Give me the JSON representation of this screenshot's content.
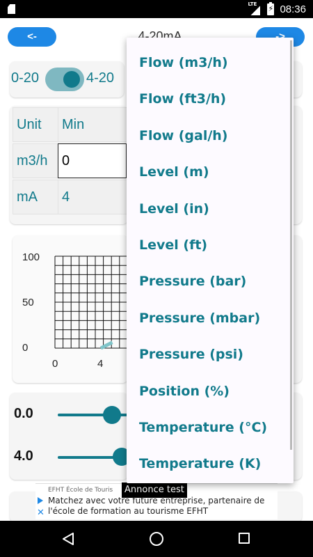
{
  "status_bar": {
    "time": "08:36",
    "network_label": "LTE",
    "battery_glyph": "⚡",
    "icons": [
      "sd-card-icon",
      "lte-signal-icon",
      "battery-charging-icon"
    ]
  },
  "header": {
    "back_label": "<-",
    "title": "4-20mA",
    "next_label": "->"
  },
  "mode_toggle": {
    "left_label": "0-20",
    "right_label": "4-20",
    "selected": "4-20"
  },
  "table": {
    "header": [
      "Unit",
      "Min"
    ],
    "rows": [
      {
        "unit": "m3/h",
        "value": "0"
      },
      {
        "unit": "mA",
        "value": "4"
      }
    ]
  },
  "chart_data": {
    "type": "line",
    "y_ticks": [
      "100",
      "50",
      "0"
    ],
    "x_ticks": [
      "0",
      "4"
    ],
    "ylim": [
      0,
      100
    ],
    "grid": true,
    "series": [
      {
        "x": [
          4,
          5
        ],
        "y": [
          0,
          6.25
        ]
      }
    ],
    "color": "#7fc4c9"
  },
  "sliders": [
    {
      "label": "0.0"
    },
    {
      "label": "4.0"
    }
  ],
  "dropdown": {
    "items": [
      "Flow (m3/h)",
      "Flow (ft3/h)",
      "Flow (gal/h)",
      "Level (m)",
      "Level (in)",
      "Level (ft)",
      "Pressure (bar)",
      "Pressure (mbar)",
      "Pressure (psi)",
      "Position (%)",
      "Temperature (°C)",
      "Temperature (K)"
    ]
  },
  "ad": {
    "badge": "Annonce test",
    "small_text": "EFHT École de Touris",
    "body_text": "Matchez avec votre future entreprise, partenaire de l'école de formation au tourisme EFHT"
  },
  "colors": {
    "accent": "#117a8b",
    "button": "#1e88e5",
    "card": "#f5f5f5",
    "menu_bg": "#fdfaff"
  }
}
